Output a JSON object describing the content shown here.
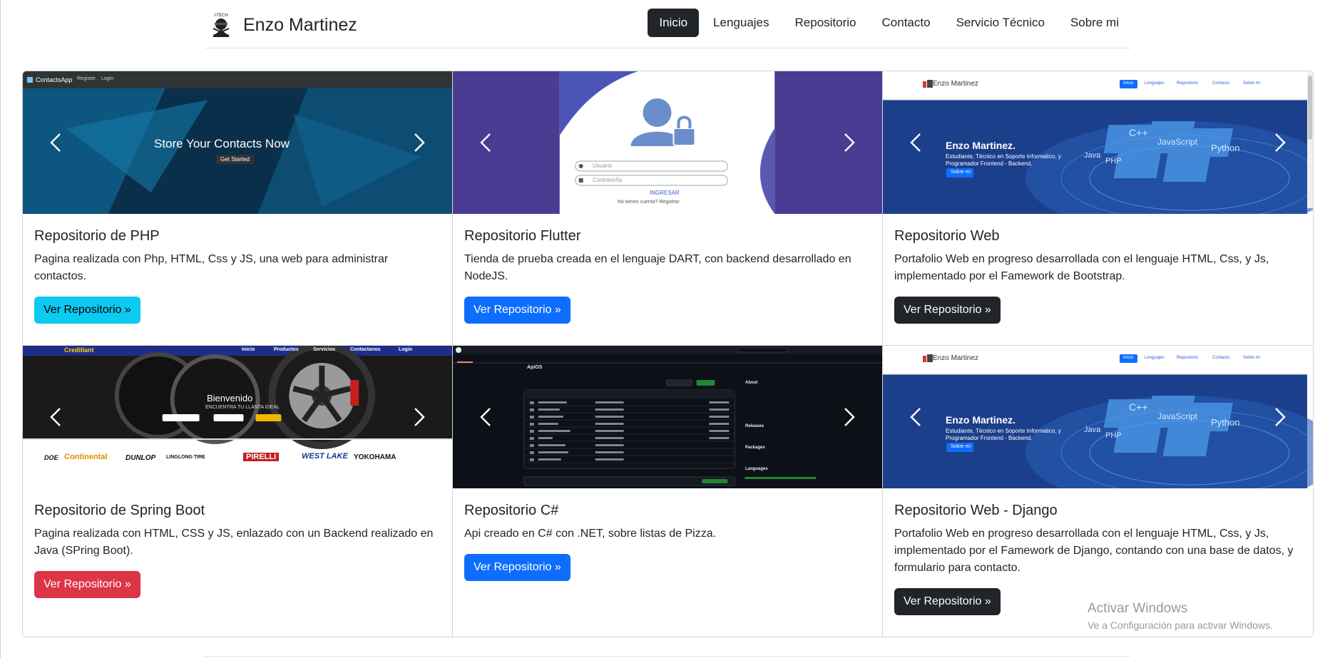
{
  "brand": {
    "name": "Enzo Martinez",
    "logo_text": "I-TECH"
  },
  "nav": [
    {
      "label": "Inicio",
      "active": true
    },
    {
      "label": "Lenguajes",
      "active": false
    },
    {
      "label": "Repositorio",
      "active": false
    },
    {
      "label": "Contacto",
      "active": false
    },
    {
      "label": "Servicio Técnico",
      "active": false
    },
    {
      "label": "Sobre mi",
      "active": false
    }
  ],
  "cards": [
    {
      "title": "Repositorio de PHP",
      "text": "Pagina realizada con Php, HTML, Css y JS, una web para administrar contactos.",
      "button": "Ver Repositorio »",
      "button_color": "#0dcaf0",
      "shot": {
        "app": "ContactsApp",
        "links": [
          "Register",
          "Login"
        ],
        "headline": "Store Your Contacts Now",
        "cta": "Get Started"
      }
    },
    {
      "title": "Repositorio Flutter",
      "text": "Tienda de prueba creada en el lenguaje DART, con backend desarrollado en NodeJS.",
      "button": "Ver Repositorio »",
      "button_color": "#0d6efd",
      "shot": {
        "user_placeholder": "Usuario",
        "pass_placeholder": "Contraseña",
        "submit": "INGRESAR",
        "footer": "No tienes cuenta? Registrar"
      }
    },
    {
      "title": "Repositorio Web",
      "text": "Portafolio Web en progreso desarrollada con el lenguaje HTML, Css, y Js, implementado por el Famework de Bootstrap.",
      "button": "Ver Repositorio »",
      "button_color": "#212529",
      "shot": {
        "brand": "Enzo Martinez",
        "links": [
          "Inicio",
          "Lenguajes",
          "Repositorio",
          "Contacto",
          "Sobre mi"
        ],
        "heading": "Enzo Martinez.",
        "line1": "Estudiante, Técnico en Soporte Informatico, y",
        "line2": "Programador Frontend - Backend.",
        "cta": "Sobre mi",
        "langs": [
          "C++",
          "JavaScript",
          "Python",
          "Java",
          "PHP"
        ]
      }
    },
    {
      "title": "Repositorio de Spring Boot",
      "text": "Pagina realizada con HTML, CSS y JS, enlazado con un Backend realizado en Java (SPring Boot).",
      "button": "Ver Repositorio »",
      "button_color": "#dc3545",
      "shot": {
        "brand": "Credillant",
        "links": [
          "Inicio",
          "Productos",
          "Servicios",
          "Contactanos",
          "Login"
        ],
        "heading": "Bienvenido",
        "sub": "ENCUENTRA TU LLANTA IDEAL",
        "brands": [
          "DOE",
          "Continental",
          "DUNLOP",
          "LINGLONG TIRE",
          "PIRELLI",
          "WEST LAKE",
          "YOKOHAMA"
        ]
      }
    },
    {
      "title": "Repositorio C#",
      "text": "Api creado en C# con .NET, sobre listas de Pizza.",
      "button": "Ver Repositorio »",
      "button_color": "#0d6efd",
      "shot": {
        "repo": "ApiOS",
        "about": "About",
        "releases": "Releases",
        "packages": "Packages",
        "languages": "Languages"
      }
    },
    {
      "title": "Repositorio Web - Django",
      "text": "Portafolio Web en progreso desarrollada con el lenguaje HTML, Css, y Js, implementado por el Famework de Django, contando con una base de datos, y formulario para contacto.",
      "button": "Ver Repositorio »",
      "button_color": "#212529",
      "shot": {
        "brand": "Enzo Martinez",
        "links": [
          "Inicio",
          "Lenguajes",
          "Repositorio",
          "Contacto",
          "Sobre mi"
        ],
        "heading": "Enzo Martinez.",
        "line1": "Estudiante, Técnico en Soporte Informatico, y",
        "line2": "Programador Frontend - Backend.",
        "cta": "Sobre mi",
        "langs": [
          "C++",
          "JavaScript",
          "Python",
          "Java",
          "PHP"
        ]
      }
    }
  ],
  "watermark": {
    "title": "Activar Windows",
    "subtitle": "Ve a Configuración para activar Windows."
  }
}
